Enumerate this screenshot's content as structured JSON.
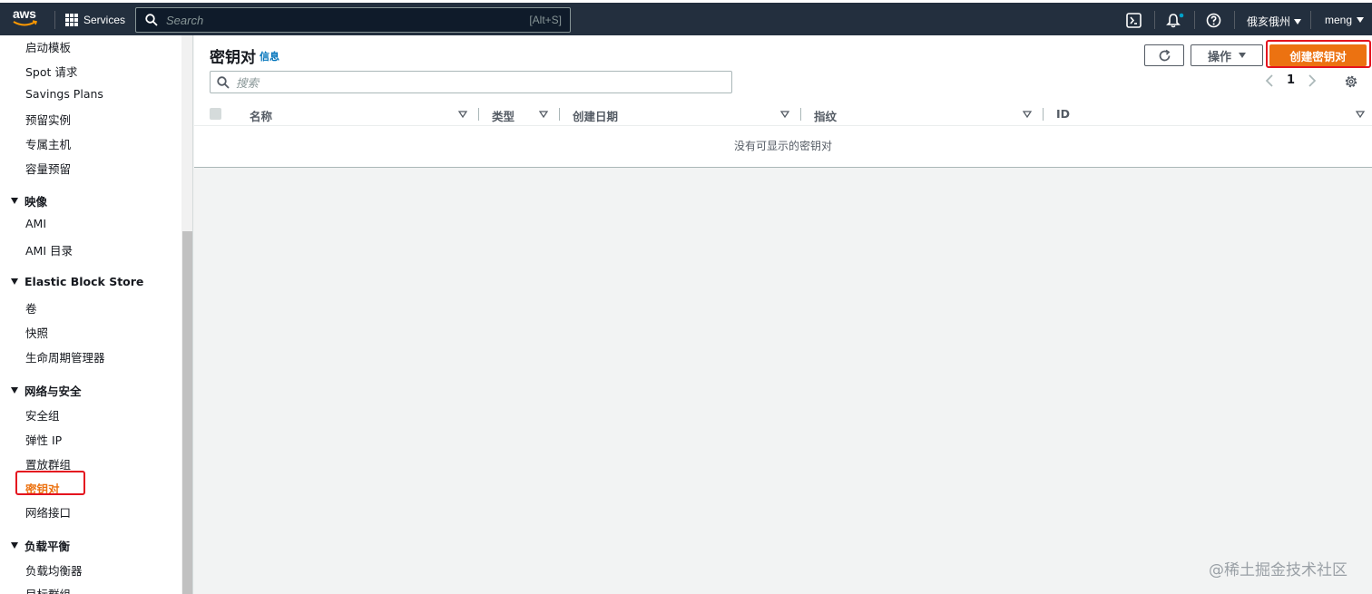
{
  "nav": {
    "logo": "aws",
    "services": "Services",
    "search_placeholder": "Search",
    "search_shortcut": "[Alt+S]",
    "region": "俄亥俄州",
    "user": "meng"
  },
  "sidebar": {
    "items_top": [
      "启动模板",
      "Spot 请求",
      "Savings Plans",
      "预留实例",
      "专属主机",
      "容量预留"
    ],
    "sections": [
      {
        "title": "映像",
        "items": [
          "AMI",
          "AMI 目录"
        ]
      },
      {
        "title": "Elastic Block Store",
        "items": [
          "卷",
          "快照",
          "生命周期管理器"
        ]
      },
      {
        "title": "网络与安全",
        "items": [
          "安全组",
          "弹性 IP",
          "置放群组",
          "密钥对",
          "网络接口"
        ]
      },
      {
        "title": "负载平衡",
        "items": [
          "负载均衡器",
          "目标群组"
        ]
      }
    ],
    "active_item": "密钥对"
  },
  "main": {
    "title": "密钥对",
    "info": "信息",
    "actions_label": "操作",
    "create_label": "创建密钥对",
    "filter_placeholder": "搜索",
    "page_number": "1",
    "columns": [
      "名称",
      "类型",
      "创建日期",
      "指纹",
      "ID"
    ],
    "empty_message": "没有可显示的密钥对"
  },
  "watermark": "@稀土掘金技术社区",
  "colors": {
    "nav_bg": "#232f3e",
    "accent": "#ec7211",
    "link": "#0073bb",
    "highlight": "#e4141f"
  }
}
